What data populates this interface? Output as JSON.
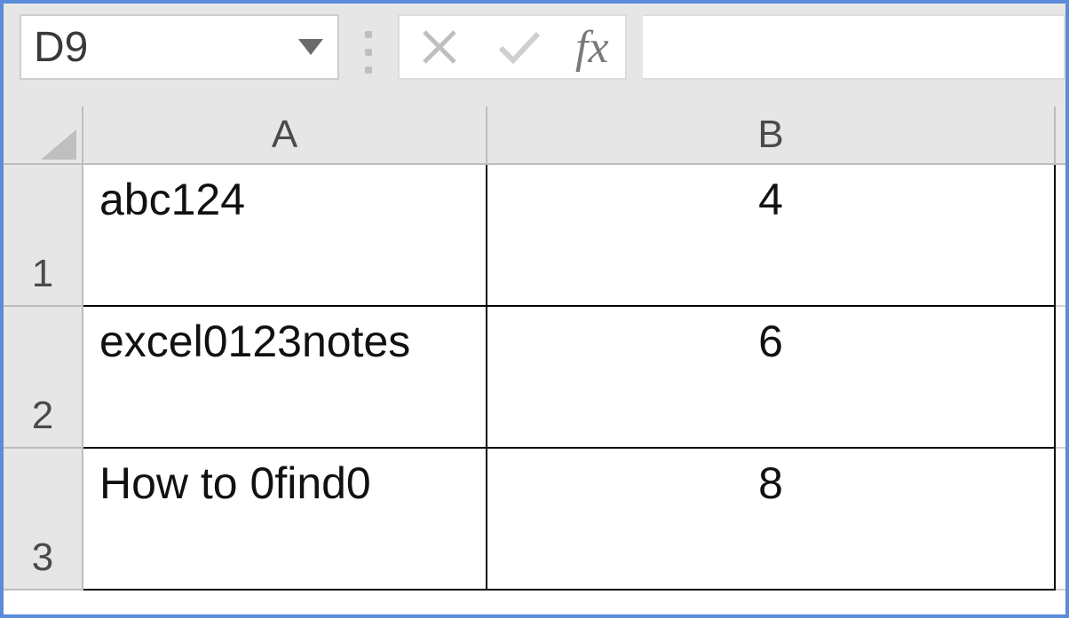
{
  "nameBox": {
    "value": "D9"
  },
  "formulaBar": {
    "cancelIcon": "cancel-icon",
    "enterIcon": "check-icon",
    "fxLabel": "fx",
    "formula": ""
  },
  "columns": [
    "A",
    "B"
  ],
  "rows": [
    "1",
    "2",
    "3"
  ],
  "cells": {
    "A1": "abc124",
    "B1": "4",
    "A2": "excel0123notes",
    "B2": "6",
    "A3": "How to 0find0",
    "B3": "8"
  }
}
